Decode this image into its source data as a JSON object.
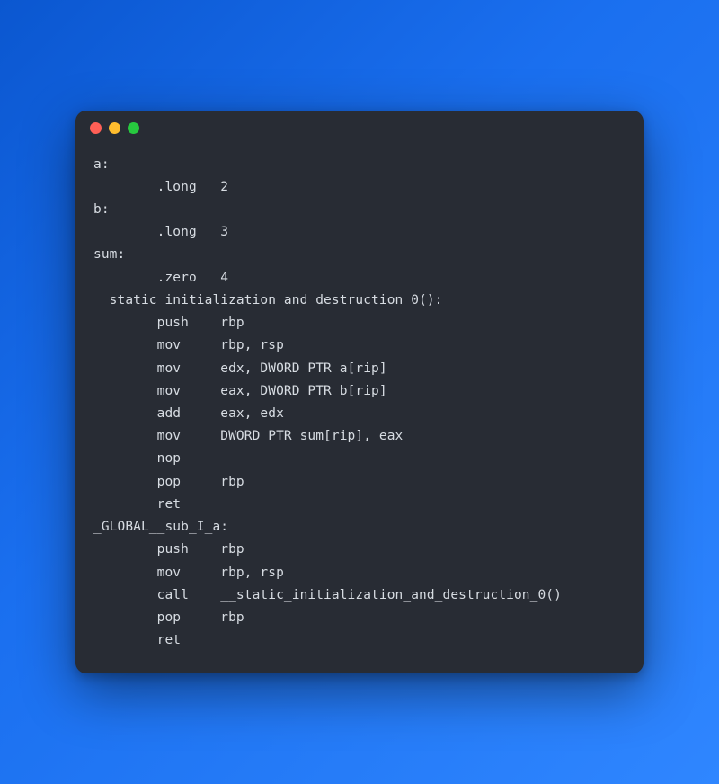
{
  "window": {
    "buttons": {
      "close": "close",
      "minimize": "minimize",
      "maximize": "maximize"
    }
  },
  "code_lines": [
    "a:",
    "        .long   2",
    "b:",
    "        .long   3",
    "sum:",
    "        .zero   4",
    "__static_initialization_and_destruction_0():",
    "        push    rbp",
    "        mov     rbp, rsp",
    "        mov     edx, DWORD PTR a[rip]",
    "        mov     eax, DWORD PTR b[rip]",
    "        add     eax, edx",
    "        mov     DWORD PTR sum[rip], eax",
    "        nop",
    "        pop     rbp",
    "        ret",
    "_GLOBAL__sub_I_a:",
    "        push    rbp",
    "        mov     rbp, rsp",
    "        call    __static_initialization_and_destruction_0()",
    "        pop     rbp",
    "        ret"
  ]
}
